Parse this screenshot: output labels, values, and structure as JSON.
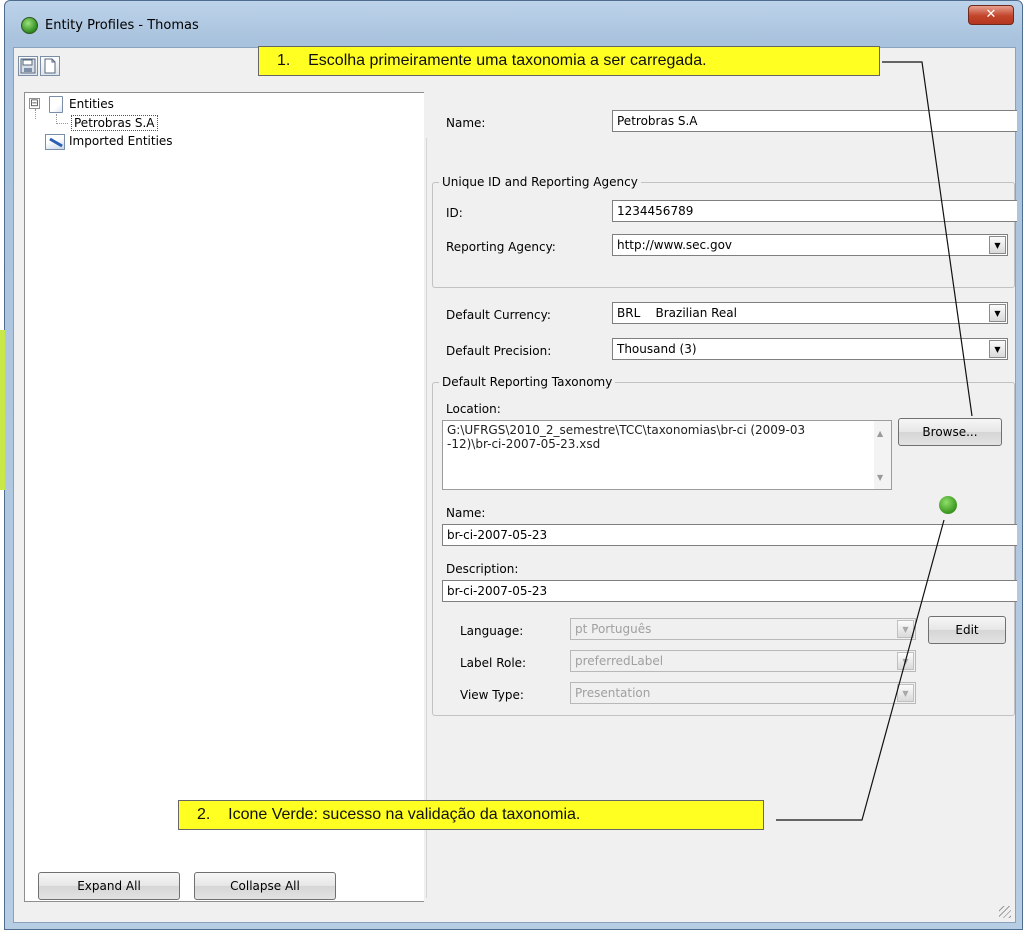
{
  "window": {
    "title": "Entity Profiles - Thomas",
    "close_label": "✕"
  },
  "toolbar": {
    "save_icon": "save-icon",
    "new_icon": "new-document-icon"
  },
  "tree": {
    "root_label": "Entities",
    "expander": "⊟",
    "child_label": "Petrobras S.A",
    "imported_label": "Imported Entities"
  },
  "entity": {
    "name_label": "Name:",
    "name_value": "Petrobras S.A"
  },
  "unique_id": {
    "group_title": "Unique ID and Reporting Agency",
    "id_label": "ID:",
    "id_value": "1234456789",
    "agency_label": "Reporting Agency:",
    "agency_value": "http://www.sec.gov"
  },
  "defaults": {
    "currency_label": "Default Currency:",
    "currency_value": "BRL    Brazilian Real",
    "precision_label": "Default Precision:",
    "precision_value": "Thousand (3)"
  },
  "taxonomy": {
    "group_title": "Default Reporting Taxonomy",
    "location_label": "Location:",
    "location_line1": "G:\\UFRGS\\2010_2_semestre\\TCC\\taxonomias\\br-ci (2009-03",
    "location_line2": "-12)\\br-ci-2007-05-23.xsd",
    "browse_label": "Browse...",
    "status": "green",
    "name_label": "Name:",
    "name_value": "br-ci-2007-05-23",
    "description_label": "Description:",
    "description_value": "br-ci-2007-05-23",
    "language_label": "Language:",
    "language_value": "pt Português",
    "edit_label": "Edit",
    "label_role_label": "Label Role:",
    "label_role_value": "preferredLabel",
    "view_type_label": "View Type:",
    "view_type_value": "Presentation"
  },
  "buttons": {
    "expand_all": "Expand All",
    "collapse_all": "Collapse All"
  },
  "annotations": {
    "callout1": "1.    Escolha primeiramente uma taxonomia a ser carregada.",
    "callout2": "2.    Icone Verde: sucesso na validação da taxonomia."
  },
  "colors": {
    "callout_bg": "#ffff22",
    "status_green": "#3f9a22"
  }
}
